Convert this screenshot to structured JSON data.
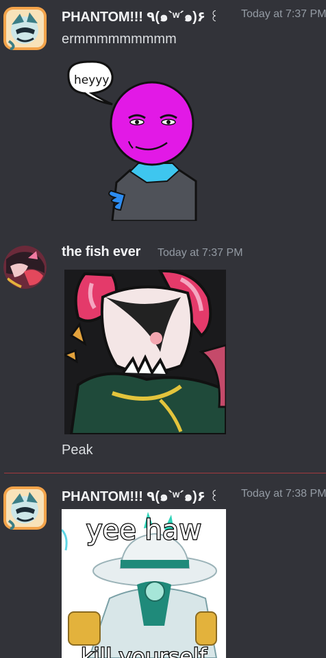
{
  "messages": [
    {
      "username": "PHANTOM!!! ٩(๑`ʷ´๑)۶",
      "decoration": "꒰",
      "timestamp": "Today at 7:37 PM",
      "text": "ermmmmmmmmm",
      "attachment": {
        "kind": "image",
        "bubble_text": "heyyy"
      }
    },
    {
      "username": "the fish ever",
      "timestamp": "Today at 7:37 PM",
      "attachment": {
        "kind": "image"
      },
      "text": "Peak"
    },
    {
      "username": "PHANTOM!!! ٩(๑`ʷ´๑)۶",
      "decoration": "꒰",
      "timestamp": "Today at 7:38 PM",
      "attachment": {
        "kind": "image",
        "top_text": "yee haw",
        "bottom_text": "kill yourself"
      }
    }
  ],
  "colors": {
    "background": "#323339",
    "username": "#f2f3f5",
    "timestamp": "#949ba4",
    "divider": "#a33a3e"
  }
}
